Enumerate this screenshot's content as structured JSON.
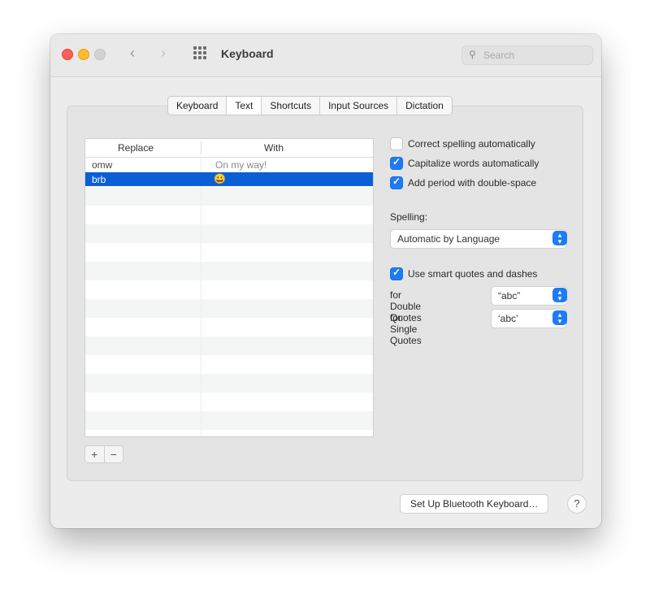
{
  "window": {
    "title": "Keyboard",
    "nav_back": "‹",
    "nav_forward": "›",
    "search_placeholder": "Search",
    "search_icon": "magnifier-icon"
  },
  "tabs": [
    {
      "label": "Keyboard",
      "active": false
    },
    {
      "label": "Text",
      "active": true
    },
    {
      "label": "Shortcuts",
      "active": false
    },
    {
      "label": "Input Sources",
      "active": false
    },
    {
      "label": "Dictation",
      "active": false
    }
  ],
  "table": {
    "columns": [
      "Replace",
      "With"
    ],
    "rows": [
      {
        "replace": "omw",
        "with": "On my way!",
        "selected": false
      },
      {
        "replace": "brb",
        "with": "😀",
        "selected": true
      }
    ]
  },
  "add_remove": {
    "add": "+",
    "remove": "−"
  },
  "options": {
    "correct_spelling": {
      "label": "Correct spelling automatically",
      "checked": false
    },
    "capitalize": {
      "label": "Capitalize words automatically",
      "checked": true
    },
    "double_space": {
      "label": "Add period with double-space",
      "checked": true
    },
    "spelling_label": "Spelling:",
    "spelling_value": "Automatic by Language",
    "smart_quotes": {
      "label": "Use smart quotes and dashes",
      "checked": true
    },
    "double_quotes_label": "for Double Quotes",
    "double_quotes_value": "“abc”",
    "single_quotes_label": "for Single Quotes",
    "single_quotes_value": "‘abc’"
  },
  "footer": {
    "bluetooth_button": "Set Up Bluetooth Keyboard…",
    "help": "?"
  },
  "colors": {
    "accent": "#1e7bf5",
    "selection": "#0a5fd6"
  }
}
